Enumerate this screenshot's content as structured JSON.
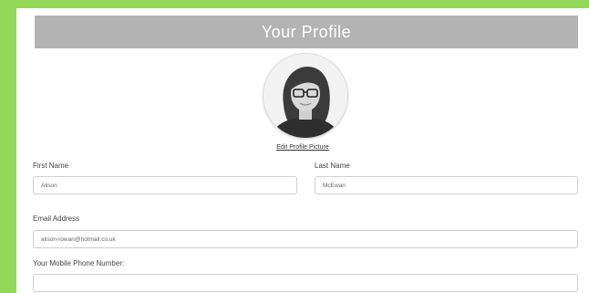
{
  "header": {
    "title": "Your Profile"
  },
  "profile": {
    "edit_picture_label": "Edit Profile Picture"
  },
  "form": {
    "first_name": {
      "label": "First Name",
      "value": "Alison"
    },
    "last_name": {
      "label": "Last Name",
      "value": "McEwan"
    },
    "email": {
      "label": "Email Address",
      "value": "alison-rowan@hotmail.co.uk"
    },
    "mobile": {
      "label": "Your Mobile Phone Number:",
      "value": ""
    }
  },
  "colors": {
    "background": "#92d95a",
    "header_bar": "#b3b3b3",
    "card": "#ffffff"
  }
}
